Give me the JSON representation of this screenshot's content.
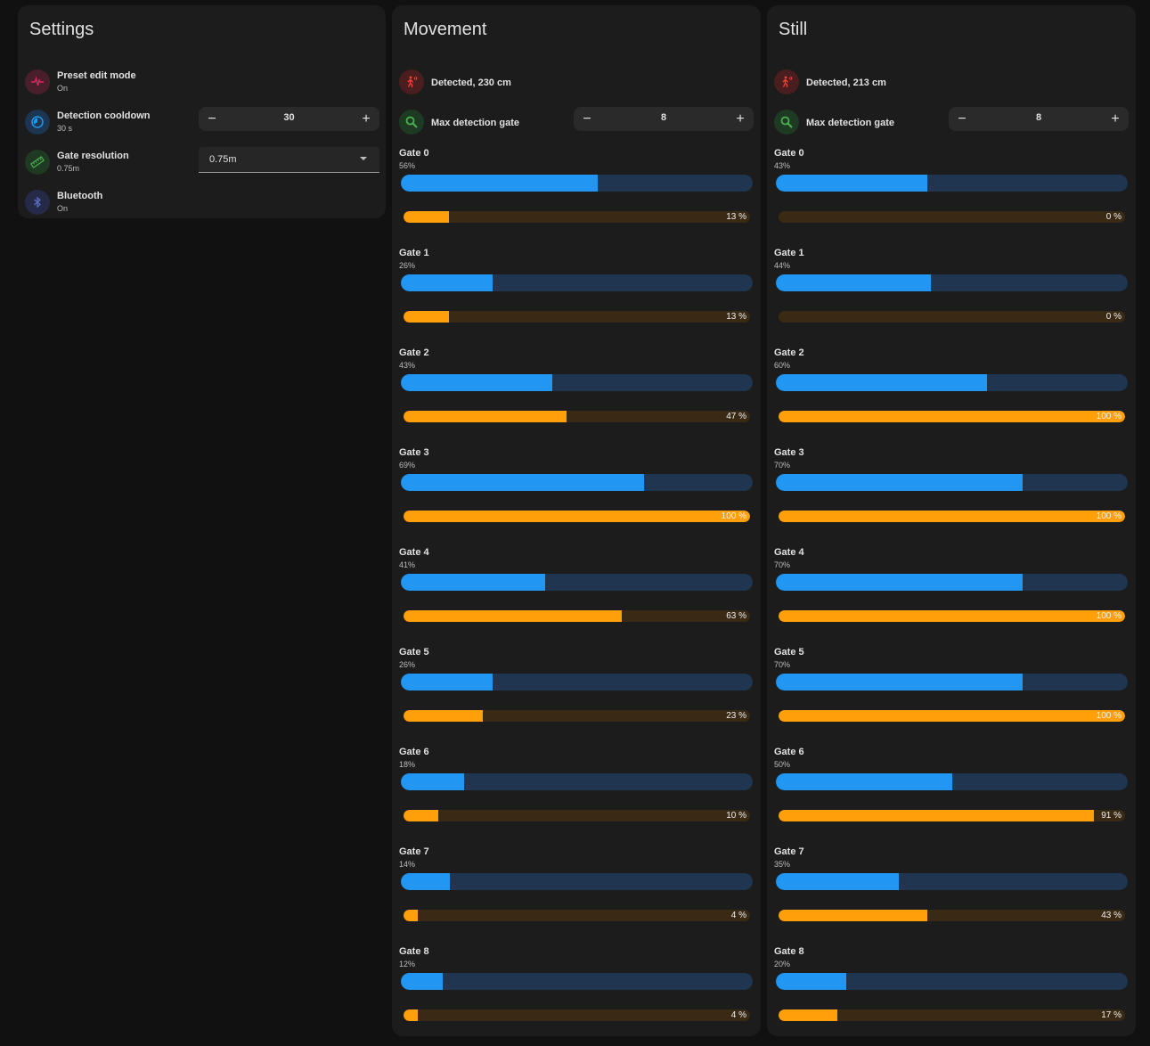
{
  "settings": {
    "title": "Settings",
    "preset_edit_mode": {
      "name": "Preset edit mode",
      "state": "On",
      "icon": "pulse-icon",
      "color": "#e91e63"
    },
    "detection_cooldown": {
      "name": "Detection cooldown",
      "state": "30 s",
      "value": "30",
      "icon": "timer-icon",
      "color": "#2196f3"
    },
    "gate_resolution": {
      "name": "Gate resolution",
      "state": "0.75m",
      "selected": "0.75m",
      "icon": "ruler-icon",
      "color": "#4caf50"
    },
    "bluetooth": {
      "name": "Bluetooth",
      "state": "On",
      "icon": "bluetooth-icon",
      "color": "#3f51b5"
    }
  },
  "movement": {
    "title": "Movement",
    "detected": "Detected, 230 cm",
    "max_gate_label": "Max detection gate",
    "max_gate_value": "8",
    "gates": [
      {
        "name": "Gate 0",
        "threshold": "56%",
        "threshold_value": 56,
        "energy": 13,
        "energy_label": "13 %"
      },
      {
        "name": "Gate 1",
        "threshold": "26%",
        "threshold_value": 26,
        "energy": 13,
        "energy_label": "13 %"
      },
      {
        "name": "Gate 2",
        "threshold": "43%",
        "threshold_value": 43,
        "energy": 47,
        "energy_label": "47 %"
      },
      {
        "name": "Gate 3",
        "threshold": "69%",
        "threshold_value": 69,
        "energy": 100,
        "energy_label": "100 %"
      },
      {
        "name": "Gate 4",
        "threshold": "41%",
        "threshold_value": 41,
        "energy": 63,
        "energy_label": "63 %"
      },
      {
        "name": "Gate 5",
        "threshold": "26%",
        "threshold_value": 26,
        "energy": 23,
        "energy_label": "23 %"
      },
      {
        "name": "Gate 6",
        "threshold": "18%",
        "threshold_value": 18,
        "energy": 10,
        "energy_label": "10 %"
      },
      {
        "name": "Gate 7",
        "threshold": "14%",
        "threshold_value": 14,
        "energy": 4,
        "energy_label": "4 %"
      },
      {
        "name": "Gate 8",
        "threshold": "12%",
        "threshold_value": 12,
        "energy": 4,
        "energy_label": "4 %"
      }
    ]
  },
  "still": {
    "title": "Still",
    "detected": "Detected, 213 cm",
    "max_gate_label": "Max detection gate",
    "max_gate_value": "8",
    "gates": [
      {
        "name": "Gate 0",
        "threshold": "43%",
        "threshold_value": 43,
        "energy": 0,
        "energy_label": "0 %"
      },
      {
        "name": "Gate 1",
        "threshold": "44%",
        "threshold_value": 44,
        "energy": 0,
        "energy_label": "0 %"
      },
      {
        "name": "Gate 2",
        "threshold": "60%",
        "threshold_value": 60,
        "energy": 100,
        "energy_label": "100 %"
      },
      {
        "name": "Gate 3",
        "threshold": "70%",
        "threshold_value": 70,
        "energy": 100,
        "energy_label": "100 %"
      },
      {
        "name": "Gate 4",
        "threshold": "70%",
        "threshold_value": 70,
        "energy": 100,
        "energy_label": "100 %"
      },
      {
        "name": "Gate 5",
        "threshold": "70%",
        "threshold_value": 70,
        "energy": 100,
        "energy_label": "100 %"
      },
      {
        "name": "Gate 6",
        "threshold": "50%",
        "threshold_value": 50,
        "energy": 91,
        "energy_label": "91 %"
      },
      {
        "name": "Gate 7",
        "threshold": "35%",
        "threshold_value": 35,
        "energy": 43,
        "energy_label": "43 %"
      },
      {
        "name": "Gate 8",
        "threshold": "20%",
        "threshold_value": 20,
        "energy": 17,
        "energy_label": "17 %"
      }
    ]
  },
  "icons": {
    "detected": "walking-person-motion-icon",
    "max_gate": "magnify-range-icon",
    "minus": "minus-icon",
    "plus": "plus-icon",
    "caret": "chevron-down-icon"
  },
  "colors": {
    "threshold_fill": "#2196f3",
    "threshold_track": "#1f3550",
    "energy_fill": "#ff9f0a",
    "energy_track": "#3a2a14",
    "detected": "#f44336",
    "max_gate": "#4caf50"
  },
  "stepper_symbols": {
    "minus": "−",
    "plus": "+"
  }
}
